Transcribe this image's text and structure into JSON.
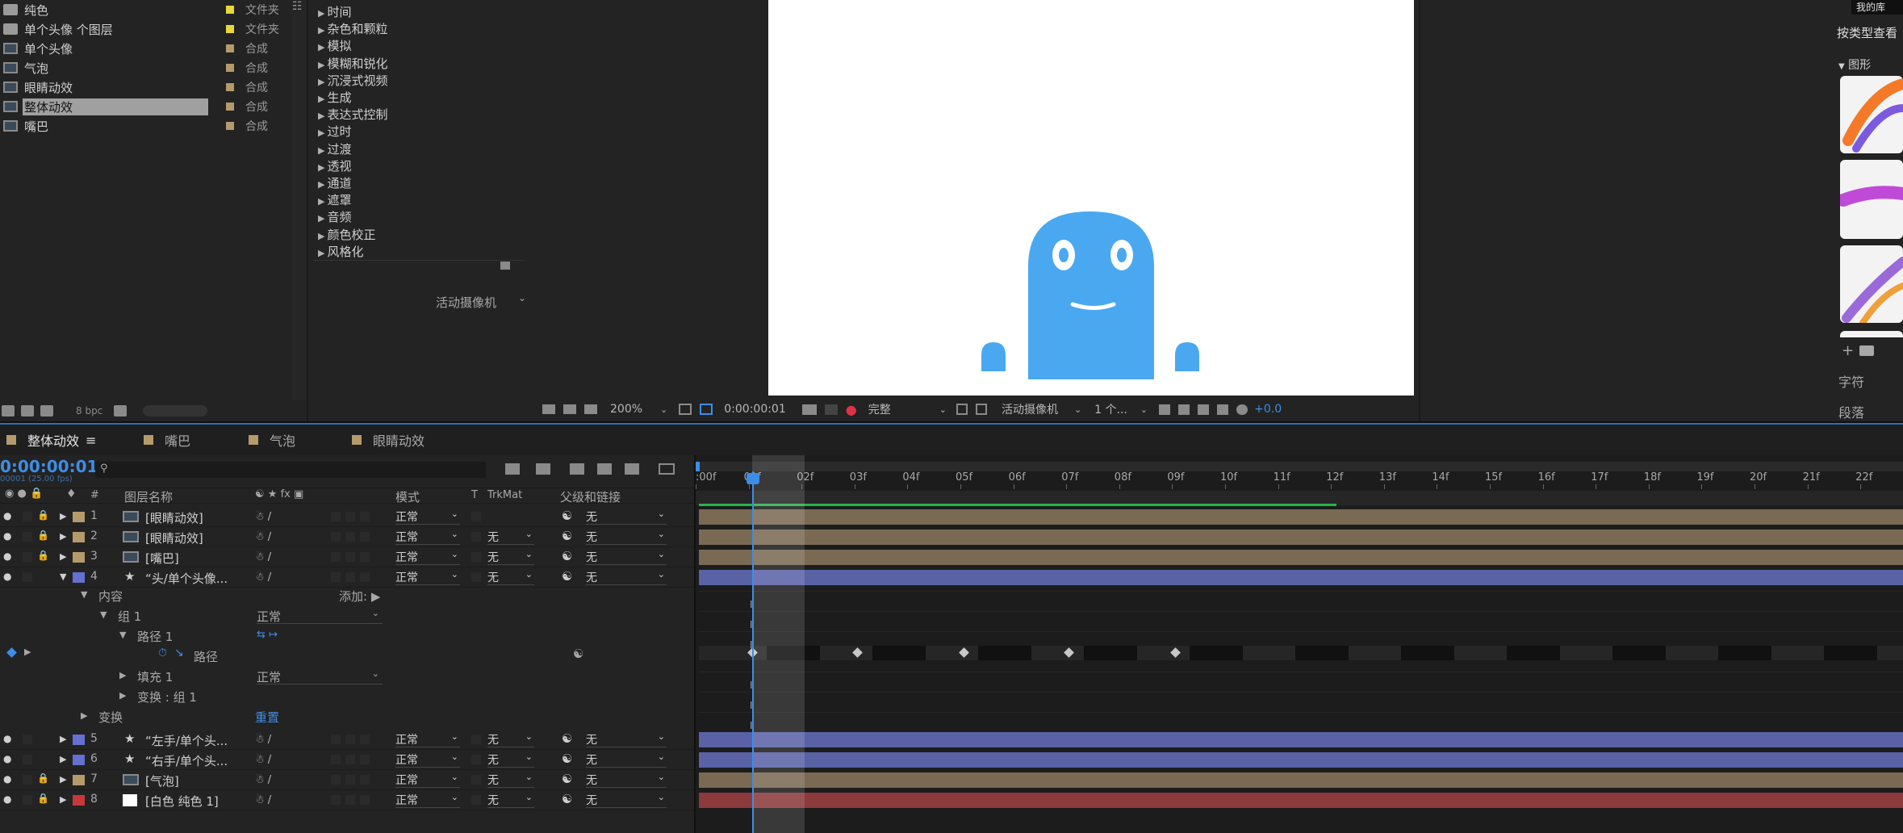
{
  "project": {
    "items": [
      {
        "name": "纯色",
        "type": "文件夹",
        "icon": "folder-icon",
        "label_color": "#e8d83a",
        "selected": false
      },
      {
        "name": "单个头像 个图层",
        "type": "文件夹",
        "icon": "folder-icon",
        "label_color": "#e8d83a",
        "selected": false
      },
      {
        "name": "单个头像",
        "type": "合成",
        "icon": "composition-icon",
        "label_color": "#b59a6c",
        "selected": false
      },
      {
        "name": "气泡",
        "type": "合成",
        "icon": "composition-icon",
        "label_color": "#b59a6c",
        "selected": false
      },
      {
        "name": "眼睛动效",
        "type": "合成",
        "icon": "composition-icon",
        "label_color": "#b59a6c",
        "selected": false
      },
      {
        "name": "整体动效",
        "type": "合成",
        "icon": "composition-icon",
        "label_color": "#b59a6c",
        "selected": true
      },
      {
        "name": "嘴巴",
        "type": "合成",
        "icon": "composition-icon",
        "label_color": "#b59a6c",
        "selected": false
      }
    ],
    "bpc": "8 bpc"
  },
  "effects": {
    "categories": [
      "时间",
      "杂色和颗粒",
      "模拟",
      "模糊和锐化",
      "沉浸式视频",
      "生成",
      "表达式控制",
      "过时",
      "过渡",
      "透视",
      "通道",
      "遮罩",
      "音频",
      "颜色校正",
      "风格化"
    ],
    "camera": "活动摄像机"
  },
  "viewer": {
    "zoom": "200%",
    "timecode": "0:00:00:01",
    "resolution": "完整",
    "camera": "活动摄像机",
    "views": "1 个...",
    "exposure": "+0.0",
    "character_color": "#4aa8f0"
  },
  "library": {
    "my_library": "我的库",
    "view_by_type": "按类型查看",
    "graphics": "图形",
    "character_tab": "字符",
    "paragraph_tab": "段落"
  },
  "timeline": {
    "tabs": [
      {
        "label": "整体动效",
        "color": "#b59a6c",
        "active": true
      },
      {
        "label": "嘴巴",
        "color": "#b59a6c",
        "active": false
      },
      {
        "label": "气泡",
        "color": "#b59a6c",
        "active": false
      },
      {
        "label": "眼睛动效",
        "color": "#b59a6c",
        "active": false
      }
    ],
    "timecode": "0:00:00:01",
    "frame_info": "00001 (25.00 fps)",
    "search_placeholder": "",
    "headers": {
      "num": "#",
      "name": "图层名称",
      "mode": "模式",
      "t": "T",
      "trkmat": "TrkMat",
      "parent": "父级和链接"
    },
    "ruler": [
      ":00f",
      "01f",
      "02f",
      "03f",
      "04f",
      "05f",
      "06f",
      "07f",
      "08f",
      "09f",
      "10f",
      "11f",
      "12f",
      "13f",
      "14f",
      "15f",
      "16f",
      "17f",
      "18f",
      "19f",
      "20f",
      "21f",
      "22f"
    ],
    "layers": [
      {
        "num": "1",
        "name": "[眼睛动效]",
        "mode": "正常",
        "trkmat": "",
        "parent": "无",
        "color": "#b59a6c",
        "icon": "composition-icon",
        "bar_color": "#7a6a54"
      },
      {
        "num": "2",
        "name": "[眼睛动效]",
        "mode": "正常",
        "trkmat": "无",
        "parent": "无",
        "color": "#b59a6c",
        "icon": "composition-icon",
        "bar_color": "#7a6a54"
      },
      {
        "num": "3",
        "name": "[嘴巴]",
        "mode": "正常",
        "trkmat": "无",
        "parent": "无",
        "color": "#b59a6c",
        "icon": "composition-icon",
        "bar_color": "#7a6a54"
      },
      {
        "num": "4",
        "name": "“头/单个头像...",
        "mode": "正常",
        "trkmat": "无",
        "parent": "无",
        "color": "#6670d0",
        "icon": "star-icon",
        "bar_color": "#5a62a6"
      }
    ],
    "sublayers": {
      "content": "内容",
      "add": "添加:",
      "group1": "组 1",
      "group1_mode": "正常",
      "path1": "路径 1",
      "path": "路径",
      "fill1": "填充 1",
      "fill1_mode": "正常",
      "transform_group": "变换 : 组 1",
      "transform": "变换",
      "reset": "重置"
    },
    "layers_lower": [
      {
        "num": "5",
        "name": "“左手/单个头...",
        "mode": "正常",
        "trkmat": "无",
        "parent": "无",
        "color": "#6670d0",
        "icon": "star-icon",
        "bar_color": "#5a62a6"
      },
      {
        "num": "6",
        "name": "“右手/单个头...",
        "mode": "正常",
        "trkmat": "无",
        "parent": "无",
        "color": "#6670d0",
        "icon": "star-icon",
        "bar_color": "#5a62a6"
      },
      {
        "num": "7",
        "name": "[气泡]",
        "mode": "正常",
        "trkmat": "无",
        "parent": "无",
        "color": "#b59a6c",
        "icon": "composition-icon",
        "bar_color": "#7a6a54"
      },
      {
        "num": "8",
        "name": "[白色 纯色 1]",
        "mode": "正常",
        "trkmat": "无",
        "parent": "无",
        "color": "#c8383a",
        "icon": "solid-icon",
        "bar_color": "#8c3a3c"
      }
    ]
  }
}
